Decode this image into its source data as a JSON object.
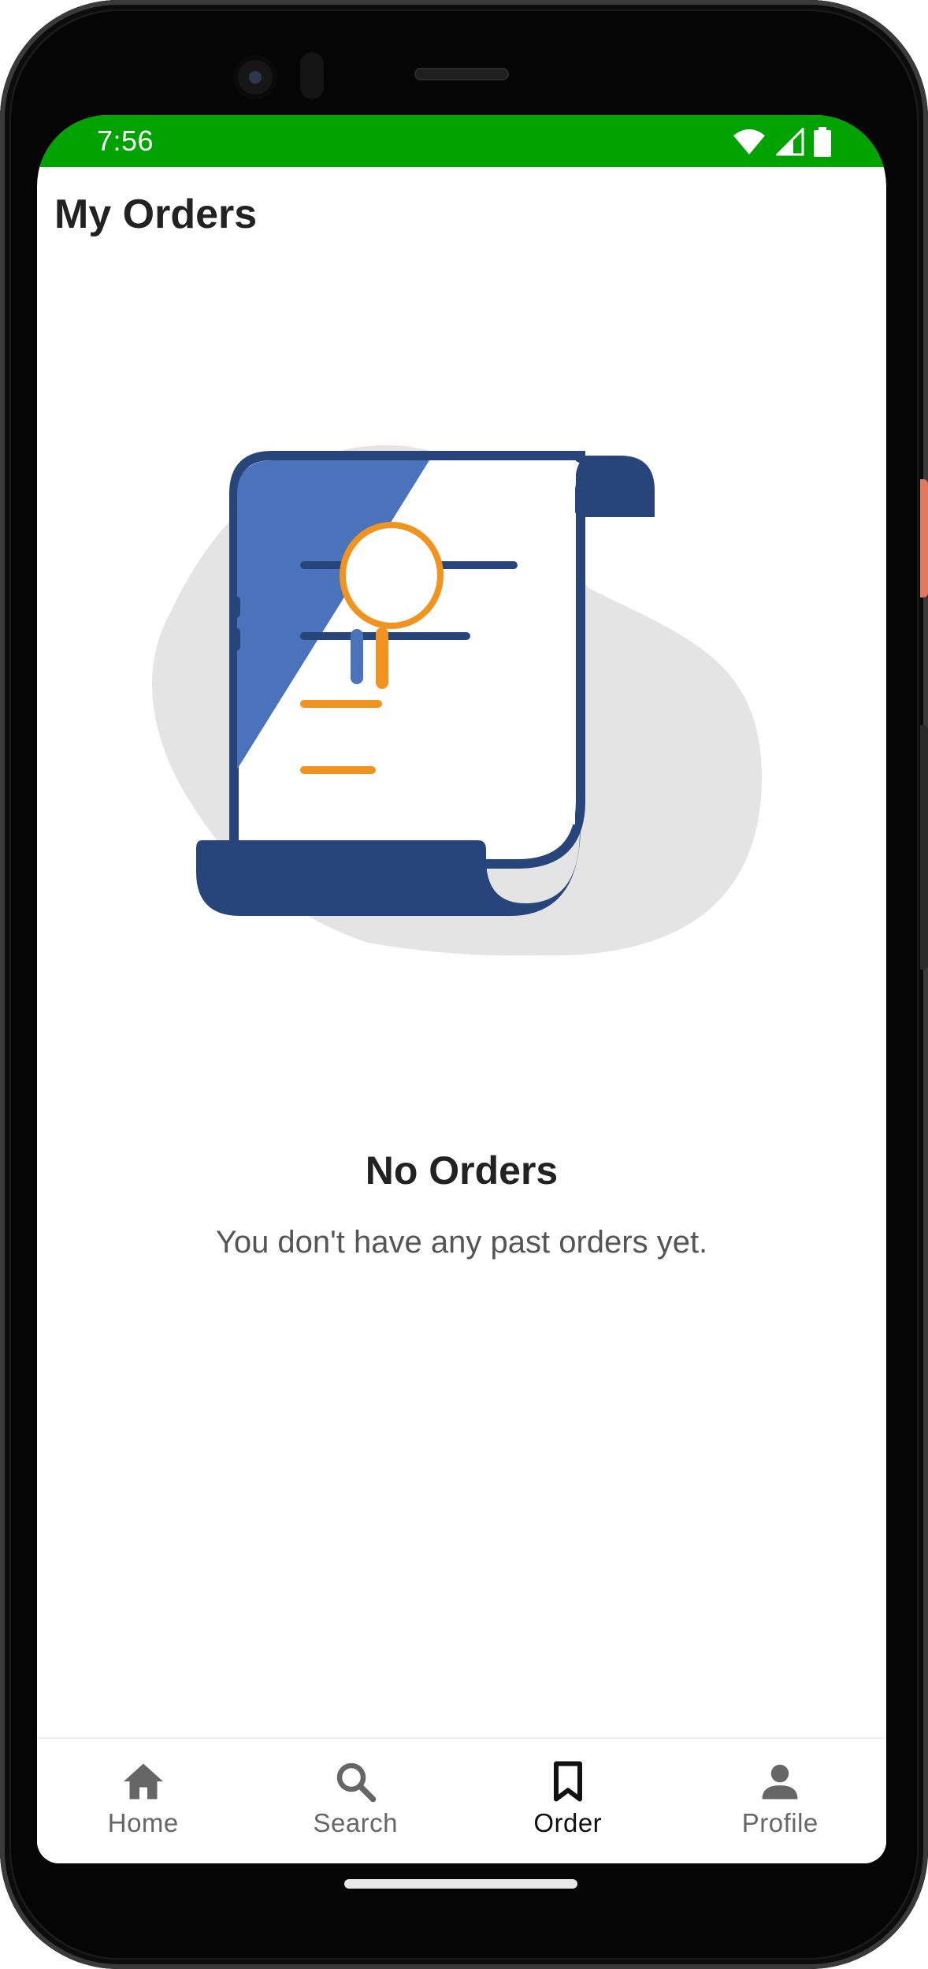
{
  "status_bar": {
    "time": "7:56",
    "background_color": "#00a300",
    "icons": [
      "wifi-icon",
      "signal-icon",
      "battery-icon"
    ]
  },
  "header": {
    "title": "My Orders"
  },
  "empty_state": {
    "illustration": "document-scroll-magnifier-icon",
    "title": "No Orders",
    "subtitle": "You don't have any past orders yet."
  },
  "bottom_nav": {
    "active": "Order",
    "items": [
      {
        "label": "Home",
        "icon": "home-icon"
      },
      {
        "label": "Search",
        "icon": "search-icon"
      },
      {
        "label": "Order",
        "icon": "bookmark-icon"
      },
      {
        "label": "Profile",
        "icon": "person-icon"
      }
    ]
  }
}
